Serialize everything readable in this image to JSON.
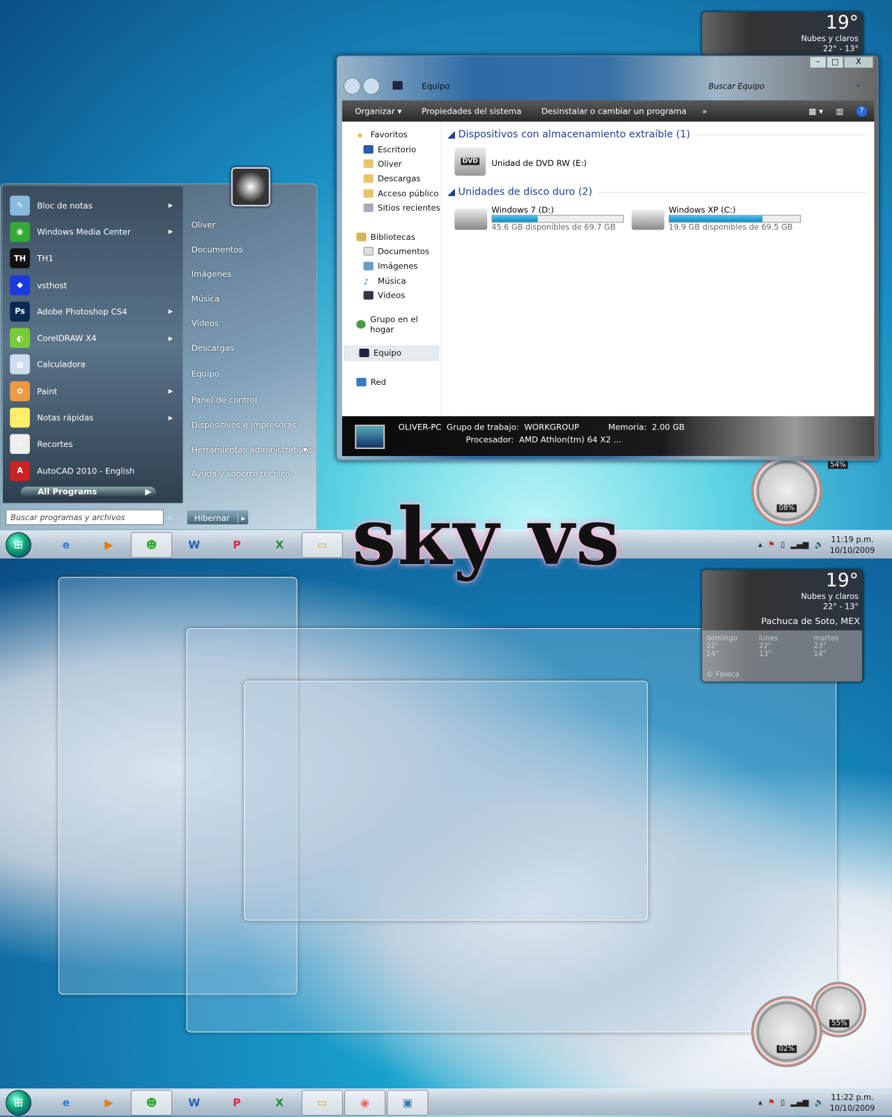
{
  "logo_text": "sky vs",
  "top": {
    "weather": {
      "temp": "19°",
      "condition": "Nubes y claros",
      "range": "22°  -  13°"
    },
    "gauges": {
      "cpu": "08%",
      "memory": "54%"
    },
    "start_menu": {
      "programs": [
        {
          "label": "Bloc de notas",
          "icon": "notepad-icon",
          "submenu": true
        },
        {
          "label": "Windows Media Center",
          "icon": "media-center-icon",
          "submenu": true
        },
        {
          "label": "TH1",
          "icon": "th1-icon",
          "submenu": false
        },
        {
          "label": "vsthost",
          "icon": "vsthost-icon",
          "submenu": false
        },
        {
          "label": "Adobe Photoshop CS4",
          "icon": "photoshop-icon",
          "submenu": true
        },
        {
          "label": "CorelDRAW X4",
          "icon": "coreldraw-icon",
          "submenu": true
        },
        {
          "label": "Calculadora",
          "icon": "calculator-icon",
          "submenu": false
        },
        {
          "label": "Paint",
          "icon": "paint-icon",
          "submenu": true
        },
        {
          "label": "Notas rápidas",
          "icon": "sticky-notes-icon",
          "submenu": true
        },
        {
          "label": "Recortes",
          "icon": "snipping-tool-icon",
          "submenu": false
        },
        {
          "label": "AutoCAD 2010 - English",
          "icon": "autocad-icon",
          "submenu": false
        }
      ],
      "all_programs": "All Programs",
      "search_placeholder": "Buscar programas y archivos",
      "right_items": [
        "Oliver",
        "Documentos",
        "Imágenes",
        "Música",
        "Vídeos",
        "Descargas",
        "Equipo",
        "Panel de control",
        "Dispositivos e impresoras",
        "Herramientas administrativas",
        "Ayuda y soporte técnico"
      ],
      "shutdown_label": "Hibernar"
    },
    "explorer": {
      "address": "Equipo",
      "search_placeholder": "Buscar Equipo",
      "toolbar": [
        "Organizar",
        "Propiedades del sistema",
        "Desinstalar o cambiar un programa"
      ],
      "more": "»",
      "nav": {
        "favorites": "Favoritos",
        "favorites_items": [
          "Escritorio",
          "Oliver",
          "Descargas",
          "Acceso público",
          "Sitios recientes"
        ],
        "libraries": "Bibliotecas",
        "libraries_items": [
          "Documentos",
          "Imágenes",
          "Música",
          "Vídeos"
        ],
        "homegroup": "Grupo en el hogar",
        "computer": "Equipo",
        "network": "Red"
      },
      "removable_header": "Dispositivos con almacenamiento extraíble (1)",
      "dvd": "Unidad de DVD RW (E:)",
      "hdd_header": "Unidades de disco duro (2)",
      "drives": [
        {
          "name": "Windows 7 (D:)",
          "free": "45.6 GB disponibles de 69.7 GB",
          "used_fraction": 0.35
        },
        {
          "name": "Windows XP (C:)",
          "free": "19.9 GB disponibles de 69.5 GB",
          "used_fraction": 0.71
        }
      ],
      "details": {
        "pc": "OLIVER-PC",
        "workgroup_label": "Grupo de trabajo:",
        "workgroup": "WORKGROUP",
        "memory_label": "Memoria:",
        "memory": "2.00 GB",
        "cpu_label": "Procesador:",
        "cpu": "AMD Athlon(tm) 64 X2 ..."
      }
    },
    "clock": {
      "time": "11:19 p.m.",
      "date": "10/10/2009"
    }
  },
  "bottom": {
    "weather": {
      "temp": "19°",
      "condition": "Nubes y claros",
      "range": "22°  -  13°",
      "location": "Pachuca de Soto, MEX",
      "forecast": [
        {
          "day": "domingo",
          "high": "22°",
          "low": "14°"
        },
        {
          "day": "lunes",
          "high": "22°",
          "low": "13°"
        },
        {
          "day": "martes",
          "high": "23°",
          "low": "14°"
        }
      ],
      "credit": "© Foreca"
    },
    "gauges": {
      "cpu": "02%",
      "memory": "55%"
    },
    "clock": {
      "time": "11:22 p.m.",
      "date": "10/10/2009"
    }
  },
  "colors": {
    "accent": "#1688c3",
    "header_blue": "#1e3d8f"
  }
}
